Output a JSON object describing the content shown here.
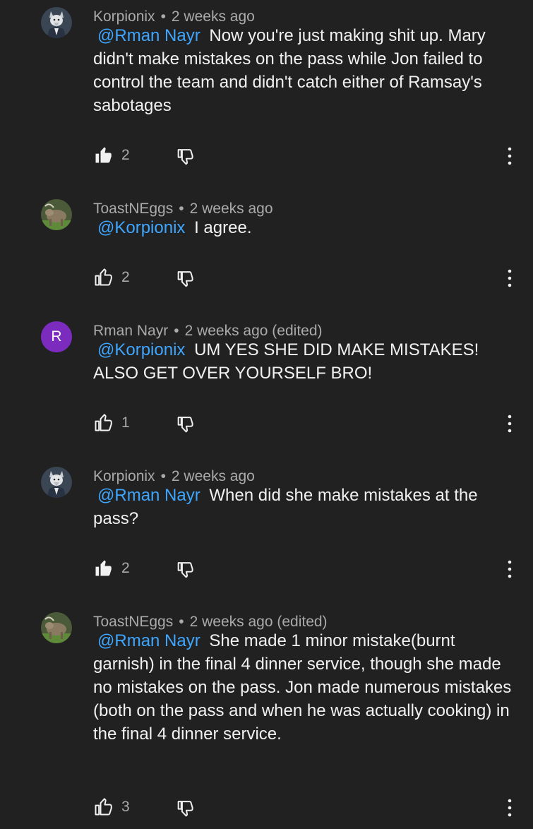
{
  "comments": [
    {
      "author": "Korpionix",
      "separator": "•",
      "time": "2 weeks ago",
      "mention": "@Rman Nayr",
      "text": "Now you're just making shit up. Mary didn't make mistakes on the pass while Jon failed to control the team and didn't catch either of Ramsay's sabotages",
      "likes": "2",
      "liked": true,
      "avatar_icon": "wolf-avatar-icon"
    },
    {
      "author": "ToastNEggs",
      "separator": "•",
      "time": "2 weeks ago",
      "mention": "@Korpionix",
      "text": "I agree.",
      "likes": "2",
      "liked": false,
      "avatar_icon": "animal-avatar-icon"
    },
    {
      "author": "Rman Nayr",
      "separator": "•",
      "time": "2 weeks ago (edited)",
      "mention": "@Korpionix",
      "text": "UM YES SHE DID MAKE MISTAKES! ALSO GET OVER YOURSELF BRO!",
      "likes": "1",
      "liked": false,
      "avatar_letter": "R",
      "avatar_color": "#7b2cbf"
    },
    {
      "author": "Korpionix",
      "separator": "•",
      "time": "2 weeks ago",
      "mention": "@Rman Nayr",
      "text": "When did she make mistakes at the pass?",
      "likes": "2",
      "liked": true,
      "avatar_icon": "wolf-avatar-icon"
    },
    {
      "author": "ToastNEggs",
      "separator": "•",
      "time": "2 weeks ago (edited)",
      "mention": "@Rman Nayr",
      "text": "She made 1 minor mistake(burnt garnish) in the final 4 dinner service, though she made no mistakes on the pass. Jon made numerous mistakes (both on the pass and when he was actually cooking) in the final 4 dinner service.",
      "likes": "3",
      "liked": false,
      "avatar_icon": "animal-avatar-icon"
    }
  ],
  "colors": {
    "background": "#212121",
    "mention": "#3ea6ff",
    "text": "#f1f1f1",
    "meta": "#aaaaaa"
  }
}
